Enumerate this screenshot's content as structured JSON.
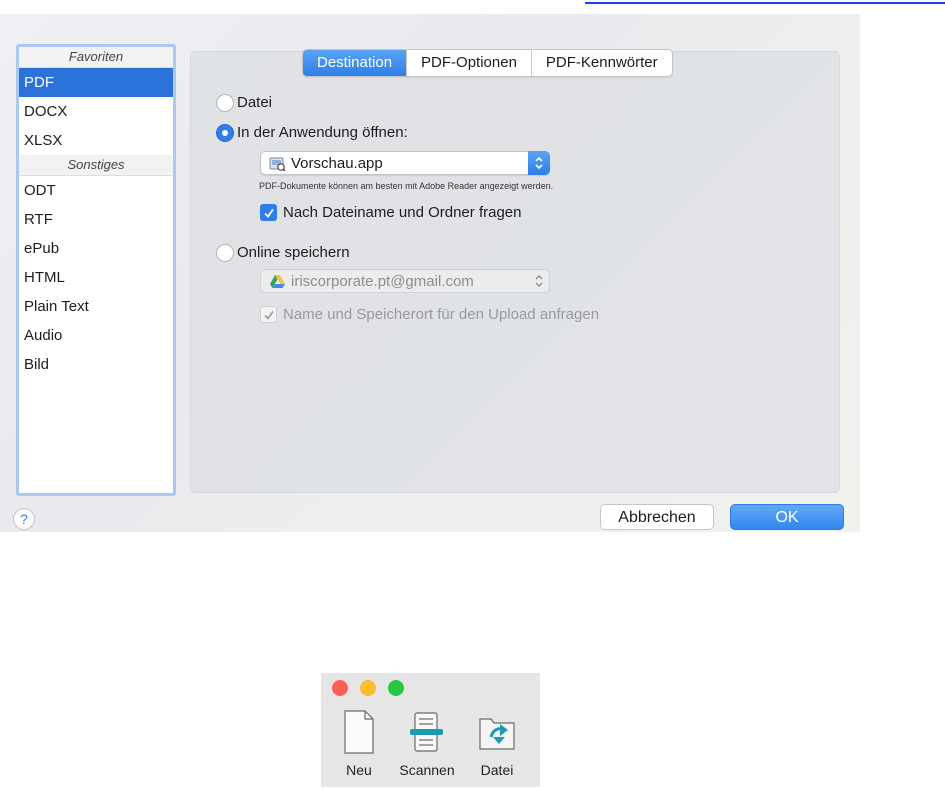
{
  "sidebar": {
    "groups": [
      {
        "header": "Favoriten",
        "items": [
          "PDF",
          "DOCX",
          "XLSX"
        ]
      },
      {
        "header": "Sonstiges",
        "items": [
          "ODT",
          "RTF",
          "ePub",
          "HTML",
          "Plain Text",
          "Audio",
          "Bild"
        ]
      }
    ],
    "selected": "PDF"
  },
  "tabs": [
    {
      "label": "Destination",
      "active": true
    },
    {
      "label": "PDF-Optionen",
      "active": false
    },
    {
      "label": "PDF-Kennwörter",
      "active": false
    }
  ],
  "destination": {
    "file_label": "Datei",
    "open_in_app_label": "In der Anwendung öffnen:",
    "app_value": "Vorschau.app",
    "note": "PDF-Dokumente können am besten mit Adobe Reader angezeigt werden.",
    "ask_filename_label": "Nach Dateiname und Ordner fragen",
    "ask_filename_checked": true,
    "online_label": "Online speichern",
    "account_value": "iriscorporate.pt@gmail.com",
    "ask_upload_label": "Name und Speicherort für den Upload anfragen",
    "ask_upload_checked": true,
    "selected_option": "open_in_app"
  },
  "footer": {
    "help_label": "?",
    "cancel_label": "Abbrechen",
    "ok_label": "OK"
  },
  "toolbar": {
    "items": [
      {
        "label": "Neu",
        "icon": "new-document-icon"
      },
      {
        "label": "Scannen",
        "icon": "scanner-icon"
      },
      {
        "label": "Datei",
        "icon": "file-folder-icon"
      }
    ]
  },
  "colors": {
    "accent": "#2f7ee8",
    "selection": "#2b73db",
    "traffic_red": "#fe5f57",
    "traffic_yellow": "#febc2e",
    "traffic_green": "#28c840",
    "toolbar_teal": "#1a9bb0"
  }
}
